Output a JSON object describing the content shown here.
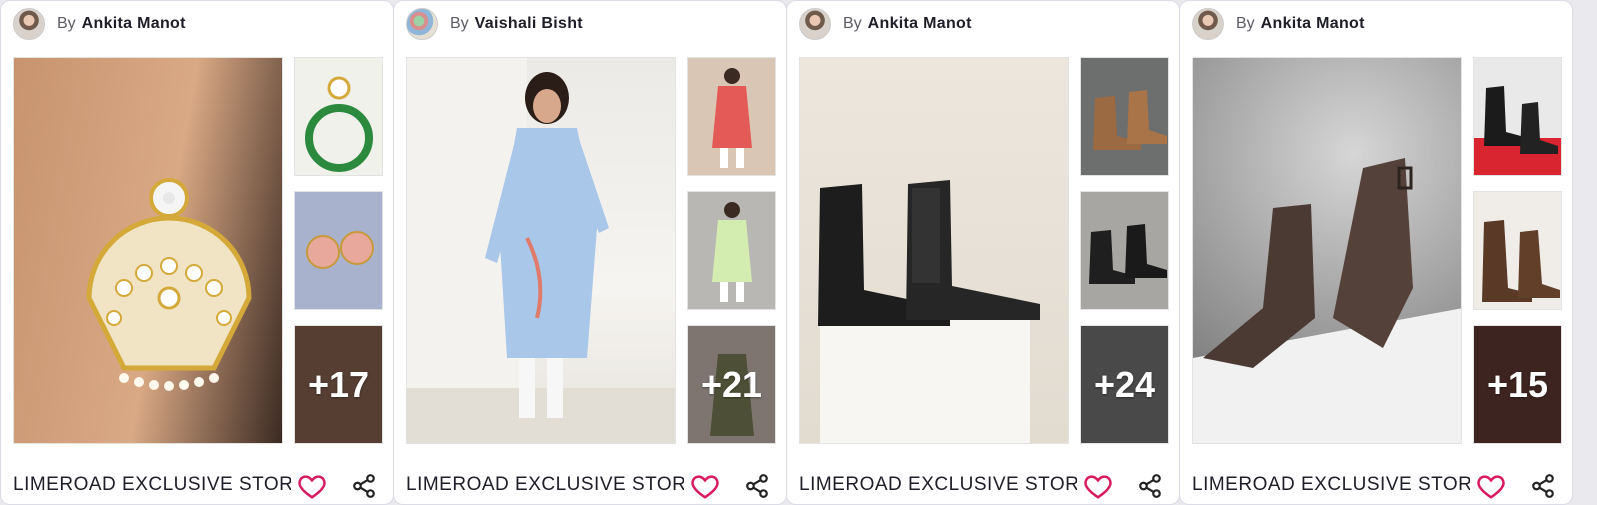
{
  "cards": [
    {
      "author_prefix": "By",
      "author": "Ankita Manot",
      "more_count": "+17",
      "store": "LIMEROAD EXCLUSIVE STOR",
      "images": [
        "earring-main-image",
        "earring-thumb-1",
        "earring-thumb-2",
        "earring-thumb-3"
      ]
    },
    {
      "author_prefix": "By",
      "author": "Vaishali Bisht",
      "more_count": "+21",
      "store": "LIMEROAD EXCLUSIVE STOR",
      "images": [
        "kurta-main-image",
        "kurta-thumb-1",
        "kurta-thumb-2",
        "kurta-thumb-3"
      ]
    },
    {
      "author_prefix": "By",
      "author": "Ankita Manot",
      "more_count": "+24",
      "store": "LIMEROAD EXCLUSIVE STOR",
      "images": [
        "boots-main-image",
        "boots-thumb-1",
        "boots-thumb-2",
        "boots-thumb-3"
      ]
    },
    {
      "author_prefix": "By",
      "author": "Ankita Manot",
      "more_count": "+15",
      "store": "LIMEROAD EXCLUSIVE STOR",
      "images": [
        "ankle-boots-main-image",
        "ankle-boots-thumb-1",
        "ankle-boots-thumb-2",
        "ankle-boots-thumb-3"
      ]
    }
  ],
  "icons": {
    "like": "heart-icon",
    "share": "share-icon"
  },
  "colors": {
    "heart": "#d81b60",
    "text": "#1e1e28"
  }
}
